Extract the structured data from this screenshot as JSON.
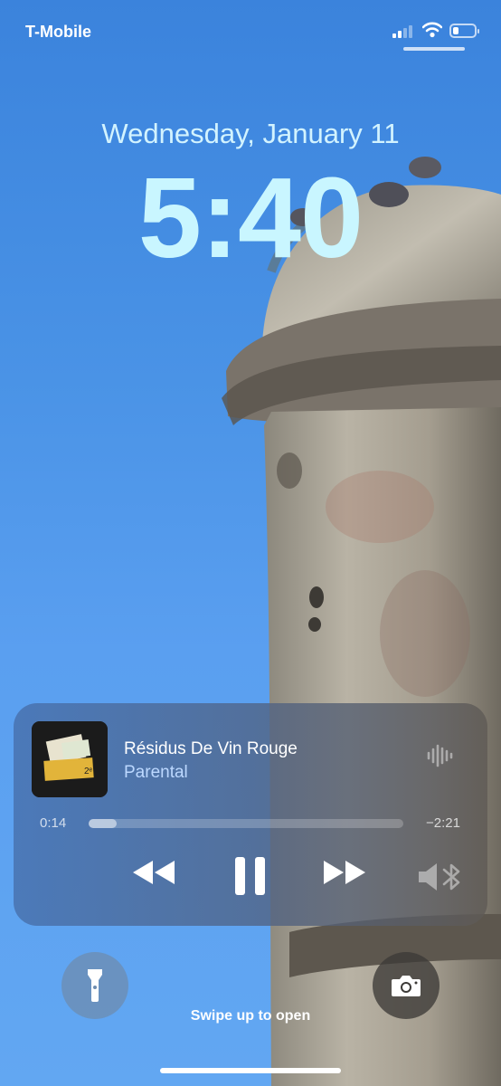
{
  "status_bar": {
    "carrier": "T-Mobile",
    "signal_bars_active": 2,
    "battery_level": 0.25
  },
  "lock_screen": {
    "date": "Wednesday, January 11",
    "time": "5:40"
  },
  "now_playing": {
    "title": "Résidus De Vin Rouge",
    "artist": "Parental",
    "elapsed": "0:14",
    "remaining": "−2:21",
    "progress": 0.09,
    "icons": {
      "rewind": "rewind-icon",
      "pause": "pause-icon",
      "forward": "fast-forward-icon",
      "audio": "audio-route-icon",
      "waveform": "waveform-icon"
    }
  },
  "bottom": {
    "swipe_hint": "Swipe up to open",
    "flashlight": "flashlight-icon",
    "camera": "camera-icon"
  },
  "colors": {
    "sky": "#4a93e6",
    "clock": "#c9f6ff",
    "artist": "#bcd8ff"
  }
}
